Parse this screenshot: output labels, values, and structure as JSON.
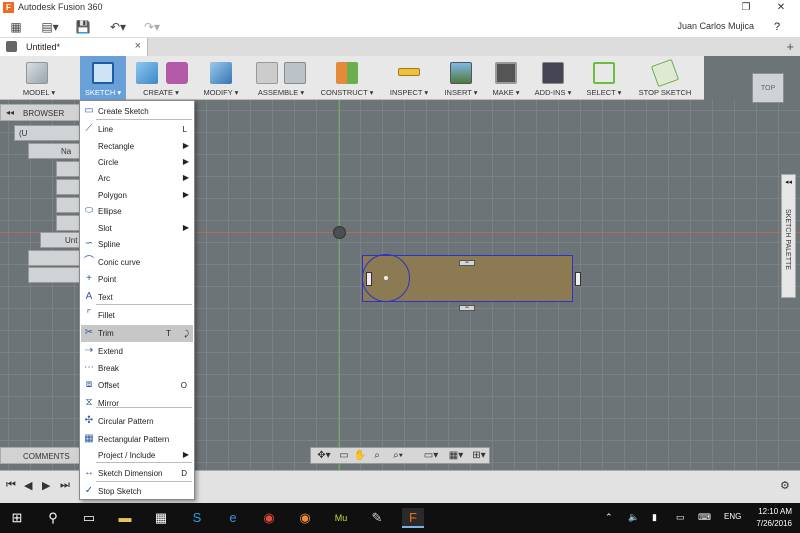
{
  "window": {
    "app_title": "Autodesk Fusion 360",
    "logo_letter": "F",
    "minimize": "—",
    "restore": "❐",
    "close": "✕"
  },
  "quickaccess": {
    "user": "Juan Carlos Mujica",
    "help": "?"
  },
  "tab": {
    "title": "Untitled*",
    "close": "×",
    "new": "+"
  },
  "toolbar": {
    "model": "MODEL ▾",
    "sketch": "SKETCH ▾",
    "create": "CREATE ▾",
    "modify": "MODIFY ▾",
    "assemble": "ASSEMBLE ▾",
    "construct": "CONSTRUCT ▾",
    "inspect": "INSPECT ▾",
    "insert": "INSERT ▾",
    "make": "MAKE ▾",
    "addins": "ADD-INS ▾",
    "select": "SELECT ▾",
    "stop_sketch": "STOP SKETCH"
  },
  "viewcube": {
    "label": "TOP"
  },
  "browser": {
    "title": "BROWSER",
    "collapse": "◂◂",
    "rows": [
      "(U",
      "Na",
      "",
      "",
      "",
      "",
      "Unt",
      "",
      ""
    ]
  },
  "comments": {
    "title": "COMMENTS"
  },
  "sketch_palette": {
    "title": "SKETCH PALETTE",
    "arrow": "◂◂"
  },
  "sketch": {
    "constraint_symbol": "═"
  },
  "menu": {
    "items": [
      {
        "label": "Create Sketch",
        "shortcut": "",
        "submenu": false,
        "icon": "create-sketch-icon",
        "glyph": "▭"
      },
      {
        "label": "Line",
        "shortcut": "L",
        "submenu": false,
        "icon": "line-icon",
        "glyph": "⟋"
      },
      {
        "label": "Rectangle",
        "shortcut": "",
        "submenu": true,
        "icon": "",
        "glyph": ""
      },
      {
        "label": "Circle",
        "shortcut": "",
        "submenu": true,
        "icon": "",
        "glyph": ""
      },
      {
        "label": "Arc",
        "shortcut": "",
        "submenu": true,
        "icon": "",
        "glyph": ""
      },
      {
        "label": "Polygon",
        "shortcut": "",
        "submenu": true,
        "icon": "",
        "glyph": ""
      },
      {
        "label": "Ellipse",
        "shortcut": "",
        "submenu": false,
        "icon": "ellipse-icon",
        "glyph": "⬭"
      },
      {
        "label": "Slot",
        "shortcut": "",
        "submenu": true,
        "icon": "",
        "glyph": ""
      },
      {
        "label": "Spline",
        "shortcut": "",
        "submenu": false,
        "icon": "spline-icon",
        "glyph": "∽"
      },
      {
        "label": "Conic curve",
        "shortcut": "",
        "submenu": false,
        "icon": "conic-curve-icon",
        "glyph": "⌒"
      },
      {
        "label": "Point",
        "shortcut": "",
        "submenu": false,
        "icon": "point-icon",
        "glyph": "+"
      },
      {
        "label": "Text",
        "shortcut": "",
        "submenu": false,
        "icon": "text-icon",
        "glyph": "A"
      },
      {
        "label": "Fillet",
        "shortcut": "",
        "submenu": false,
        "icon": "fillet-icon",
        "glyph": "⌜"
      },
      {
        "label": "Trim",
        "shortcut": "T",
        "submenu": false,
        "icon": "trim-icon",
        "glyph": "✂"
      },
      {
        "label": "Extend",
        "shortcut": "",
        "submenu": false,
        "icon": "extend-icon",
        "glyph": "⇢"
      },
      {
        "label": "Break",
        "shortcut": "",
        "submenu": false,
        "icon": "break-icon",
        "glyph": "⋯"
      },
      {
        "label": "Offset",
        "shortcut": "O",
        "submenu": false,
        "icon": "offset-icon",
        "glyph": "⧈"
      },
      {
        "label": "Mirror",
        "shortcut": "",
        "submenu": false,
        "icon": "mirror-icon",
        "glyph": "⧖"
      },
      {
        "label": "Circular Pattern",
        "shortcut": "",
        "submenu": false,
        "icon": "circular-pattern-icon",
        "glyph": "✣"
      },
      {
        "label": "Rectangular Pattern",
        "shortcut": "",
        "submenu": false,
        "icon": "rectangular-pattern-icon",
        "glyph": "▦"
      },
      {
        "label": "Project / Include",
        "shortcut": "",
        "submenu": true,
        "icon": "",
        "glyph": ""
      },
      {
        "label": "Sketch Dimension",
        "shortcut": "D",
        "submenu": false,
        "icon": "sketch-dimension-icon",
        "glyph": "↔"
      },
      {
        "label": "Stop Sketch",
        "shortcut": "",
        "submenu": false,
        "icon": "stop-sketch-icon",
        "glyph": "✓"
      }
    ],
    "highlighted": "Trim",
    "submenu_arrow": "▶",
    "trim_extra_glyph": "⤸"
  },
  "taskbar": {
    "language": "ENG",
    "time": "12:10 AM",
    "date": "7/26/2016"
  },
  "colors": {
    "accent": "#6aa0d8",
    "profile_fill": "#8c7a52",
    "sketch_line": "#2d33c8"
  }
}
